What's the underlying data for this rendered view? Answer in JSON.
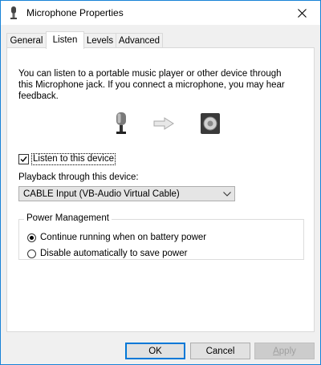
{
  "window": {
    "title": "Microphone Properties",
    "title_icon": "microphone-icon",
    "close_icon": "close-icon"
  },
  "tabs": [
    {
      "label": "General",
      "active": false
    },
    {
      "label": "Listen",
      "active": true
    },
    {
      "label": "Levels",
      "active": false
    },
    {
      "label": "Advanced",
      "active": false
    }
  ],
  "listen": {
    "description_lines": [
      "You can listen to a portable music player or other device through",
      "this Microphone jack.  If you connect a microphone, you may hear",
      "feedback."
    ],
    "icons": [
      "microphone-icon",
      "arrow-right-icon",
      "speaker-icon"
    ],
    "listen_checkbox": {
      "label": "Listen to this device",
      "checked": true
    },
    "playback_label": "Playback through this device:",
    "playback_select": {
      "value": "CABLE Input (VB-Audio Virtual Cable)"
    },
    "power": {
      "title": "Power Management",
      "options": [
        {
          "label": "Continue running when on battery power",
          "selected": true
        },
        {
          "label": "Disable automatically to save power",
          "selected": false
        }
      ]
    }
  },
  "buttons": {
    "ok": "OK",
    "cancel": "Cancel",
    "apply": "Apply"
  },
  "colors": {
    "accent": "#0078d7",
    "window_border": "#1883d7"
  }
}
